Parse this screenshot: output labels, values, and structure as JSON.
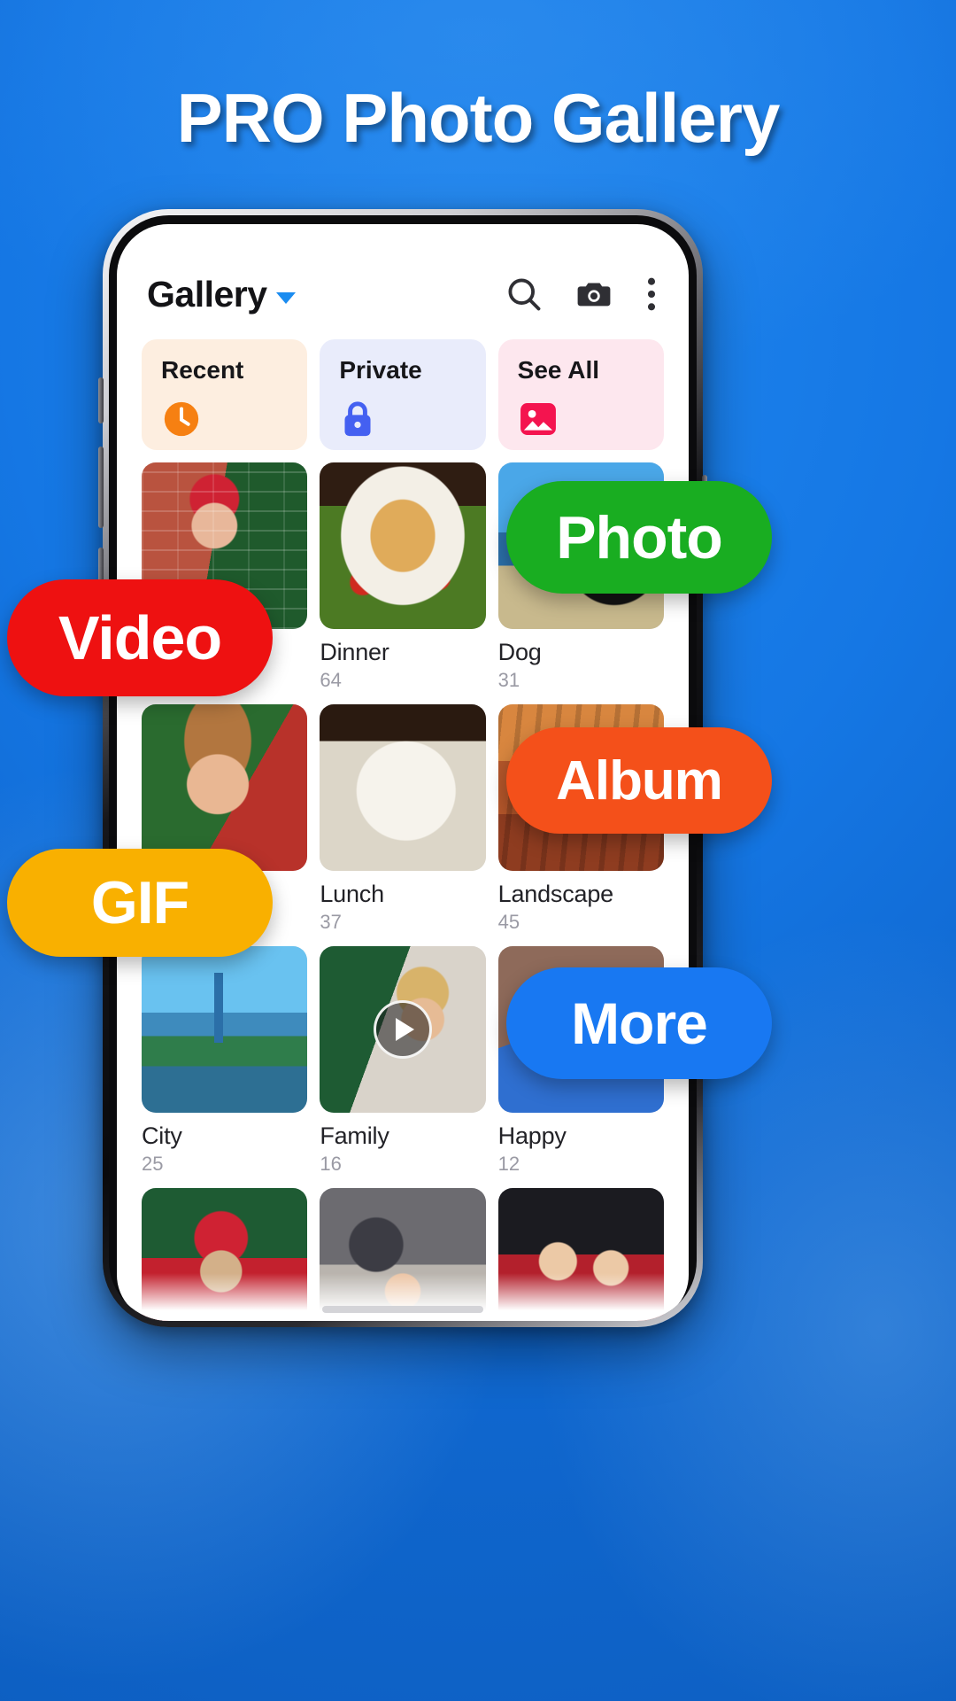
{
  "promo": {
    "headline": "PRO Photo Gallery",
    "background_color": "#1577e4"
  },
  "app": {
    "header": {
      "title": "Gallery",
      "dropdown_icon": "chevron-down-icon",
      "dropdown_color": "#1b8cf0",
      "actions": [
        {
          "name": "search-icon",
          "label": "Search"
        },
        {
          "name": "camera-icon",
          "label": "Camera"
        },
        {
          "name": "overflow-menu-icon",
          "label": "More options"
        }
      ]
    },
    "quick_chips": [
      {
        "label": "Recent",
        "icon": "clock-icon",
        "bg": "#fdeee0",
        "icon_color": "#f68012"
      },
      {
        "label": "Private",
        "icon": "lock-icon",
        "bg": "#e9ecfb",
        "icon_color": "#4460f1"
      },
      {
        "label": "See All",
        "icon": "image-icon",
        "bg": "#fde7ee",
        "icon_color": "#f4144f"
      }
    ],
    "albums": [
      {
        "name": "",
        "count": "",
        "art": "a-santa",
        "video": false
      },
      {
        "name": "Dinner",
        "count": "64",
        "art": "a-dinner",
        "video": false
      },
      {
        "name": "Dog",
        "count": "31",
        "art": "a-dog",
        "video": false
      },
      {
        "name": "",
        "count": "",
        "art": "a-girl",
        "video": false
      },
      {
        "name": "Lunch",
        "count": "37",
        "art": "a-lunch",
        "video": false
      },
      {
        "name": "Landscape",
        "count": "45",
        "art": "a-land",
        "video": false
      },
      {
        "name": "City",
        "count": "25",
        "art": "a-city",
        "video": false
      },
      {
        "name": "Family",
        "count": "16",
        "art": "a-family",
        "video": true
      },
      {
        "name": "Happy",
        "count": "12",
        "art": "a-happy",
        "video": false
      },
      {
        "name": "",
        "count": "",
        "art": "a-pug",
        "video": false
      },
      {
        "name": "",
        "count": "",
        "art": "a-kiss",
        "video": false
      },
      {
        "name": "",
        "count": "",
        "art": "a-sisters",
        "video": false
      }
    ]
  },
  "feature_badges": [
    {
      "label": "Video",
      "color": "#ee1111",
      "class": "p-video"
    },
    {
      "label": "Photo",
      "color": "#19ad21",
      "class": "p-photo"
    },
    {
      "label": "GIF",
      "color": "#f9b000",
      "class": "p-gif"
    },
    {
      "label": "Album",
      "color": "#f4501a",
      "class": "p-album"
    },
    {
      "label": "More",
      "color": "#1878f2",
      "class": "p-more"
    }
  ]
}
